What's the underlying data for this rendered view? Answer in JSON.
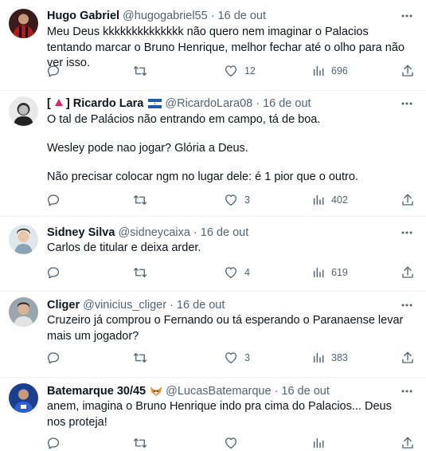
{
  "colors": {
    "text": "#0f1419",
    "muted": "#536471",
    "divider": "#eff3f4"
  },
  "tweets": [
    {
      "name": "Hugo Gabriel",
      "handle": "@hugogabriel55",
      "sep": "·",
      "date": "16 de out",
      "paragraphs": [
        "Meu Deus kkkkkkkkkkkkkk não quero nem imaginar o Palacios tentando marcar o Bruno Henrique, melhor fechar até o olho para não ver isso."
      ],
      "replies": "",
      "retweets": "",
      "likes": "12",
      "views": "696",
      "avatar_icon": "avatar-red-jersey"
    },
    {
      "name_prefix": "[",
      "name": "Ricardo Lara",
      "name_suffix": "]",
      "handle": "@RicardoLara08",
      "sep": "·",
      "date": "16 de out",
      "paragraphs": [
        "O tal de Palácios não entrando em campo, tá de boa.",
        "Wesley pode nao jogar? Glória a Deus.",
        "Não precisar colocar ngm no lugar dele: é 1 pior que o outro."
      ],
      "replies": "",
      "retweets": "",
      "likes": "3",
      "views": "402",
      "avatar_icon": "avatar-bw-portrait",
      "badge_icon": "red-triangle-icon",
      "flag_icon": "honduras-flag-icon"
    },
    {
      "name": "Sidney Silva",
      "handle": "@sidneycaixa",
      "sep": "·",
      "date": "16 de out",
      "paragraphs": [
        "Carlos de titular e deixa arder."
      ],
      "replies": "",
      "retweets": "",
      "likes": "4",
      "views": "619",
      "avatar_icon": "avatar-cartoon"
    },
    {
      "name": "Cliger",
      "handle": "@vinicius_cliger",
      "sep": "·",
      "date": "16 de out",
      "paragraphs": [
        "Cruzeiro já comprou o Fernando ou tá esperando o Paranaense levar mais um jogador?"
      ],
      "replies": "",
      "retweets": "",
      "likes": "3",
      "views": "383",
      "avatar_icon": "avatar-person-gray"
    },
    {
      "name": "Batemarque 30/45",
      "handle": "@LucasBatemarque",
      "sep": "·",
      "date": "16 de out",
      "paragraphs": [
        "anem, imagina o Bruno Henrique indo pra cima do Palacios... Deus nos proteja!"
      ],
      "replies": "",
      "retweets": "",
      "likes": "",
      "views": "",
      "avatar_icon": "avatar-blue-jersey",
      "badge_icon": "fox-emoji-icon"
    }
  ]
}
